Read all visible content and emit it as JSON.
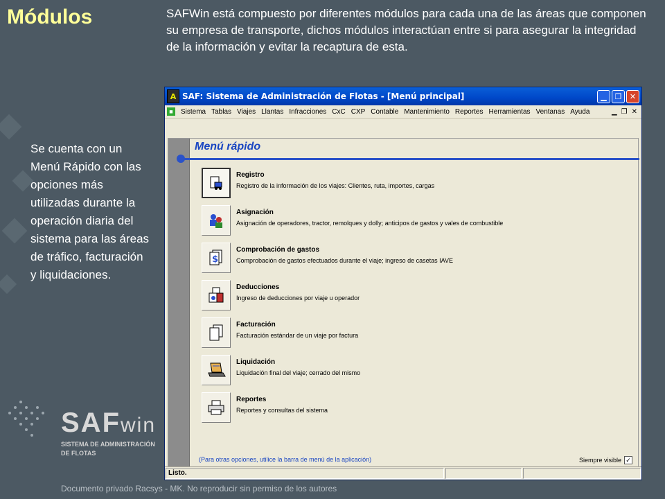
{
  "slide": {
    "title": "Módulos",
    "intro": "SAFWin está compuesto por diferentes módulos para cada una de las áreas que componen su empresa de transporte, dichos módulos interactúan entre si para asegurar la integridad de la información y evitar la recaptura de esta.",
    "side_text": "Se cuenta con un Menú Rápido con las opciones más utilizadas durante la operación diaria del sistema para las áreas de tráfico, facturación y liquidaciones.",
    "footer": "Documento privado Racsys - MK. No reproducir sin permiso de los autores",
    "logo": {
      "main": "SAF",
      "win": "win",
      "sub1": "SISTEMA DE ADMINISTRACIÓN",
      "sub2": "DE FLOTAS"
    }
  },
  "window": {
    "title": "SAF: Sistema de Administración de Flotas - [Menú principal]",
    "app_icon_letter": "A",
    "menu": [
      "Sistema",
      "Tablas",
      "Viajes",
      "Llantas",
      "Infracciones",
      "CxC",
      "CXP",
      "Contable",
      "Mantenimiento",
      "Reportes",
      "Herramientas",
      "Ventanas",
      "Ayuda"
    ],
    "panel_title": "Menú rápido",
    "items": [
      {
        "label": "Registro",
        "desc": "Registro de la información de los viajes: Clientes, ruta, importes, cargas",
        "icon": "truck-document-icon"
      },
      {
        "label": "Asignación",
        "desc": "Asignación de operadores, tractor, remolques y dolly; anticipos de gastos y vales de combustible",
        "icon": "people-icon"
      },
      {
        "label": "Comprobación de gastos",
        "desc": "Comprobación de gastos efectuados durante el viaje; ingreso de casetas IAVE",
        "icon": "money-document-icon"
      },
      {
        "label": "Deducciones",
        "desc": "Ingreso de deducciones por viaje u operador",
        "icon": "deductions-icon"
      },
      {
        "label": "Facturación",
        "desc": "Facturación estándar de un viaje por factura",
        "icon": "documents-icon"
      },
      {
        "label": "Liquidación",
        "desc": "Liquidación final del viaje; cerrado del mismo",
        "icon": "laptop-icon"
      },
      {
        "label": "Reportes",
        "desc": "Reportes y consultas del sistema",
        "icon": "printer-icon"
      }
    ],
    "hint": "(Para otras opciones, utilice la barra de menú de la aplicación)",
    "always_visible_label": "Siempre visible",
    "always_visible_checked": "✓",
    "status": "Listo."
  }
}
